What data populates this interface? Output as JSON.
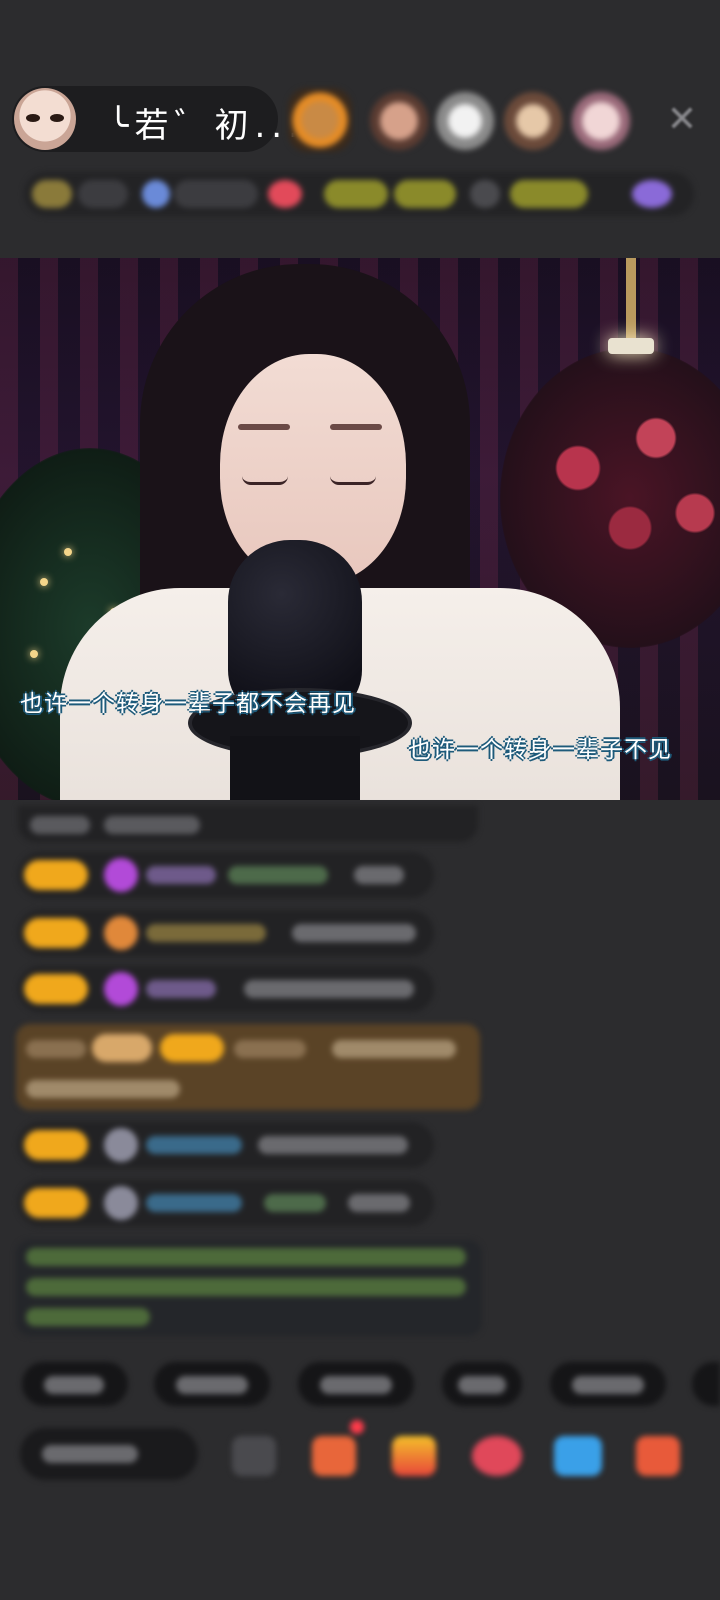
{
  "header": {
    "host_name": "╰若゛初..."
  },
  "video": {
    "lyric_left": "也许一个转身一辈子都不会再见",
    "lyric_right": "也许一个转身一辈子不见"
  },
  "colors": {
    "background": "#2c2c2e",
    "badge": "#f0a81c",
    "lyric_outline": "#1d5a7a"
  },
  "icons": [
    "close-icon",
    "gift-icon",
    "more-icon"
  ]
}
